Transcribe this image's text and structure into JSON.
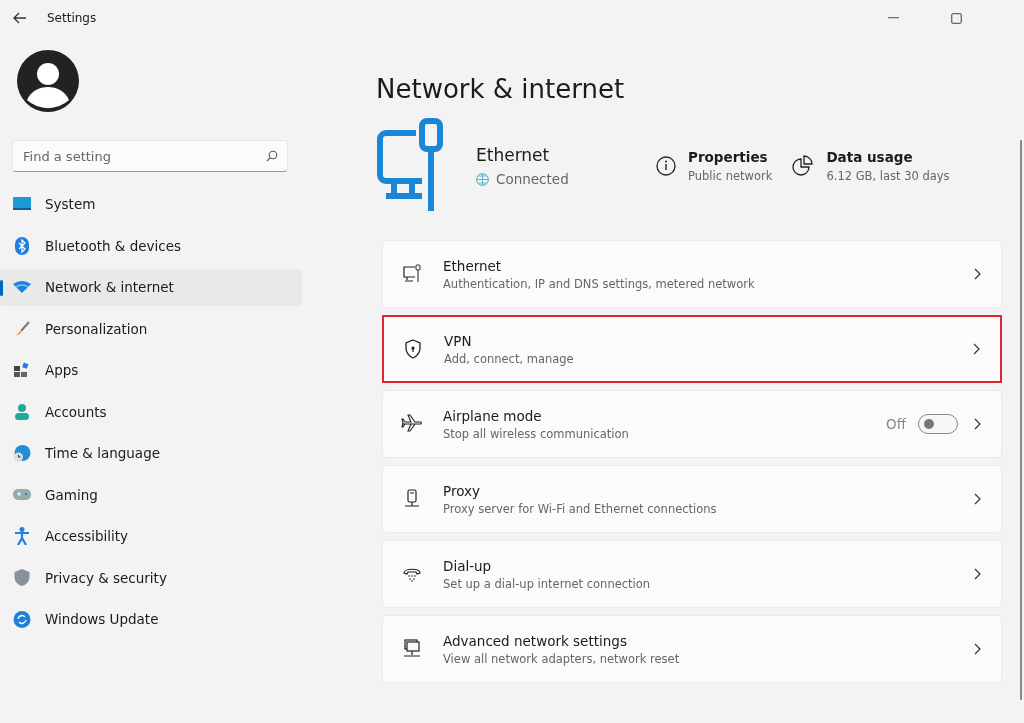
{
  "window": {
    "title": "Settings"
  },
  "search": {
    "placeholder": "Find a setting"
  },
  "sidebar": {
    "items": [
      {
        "label": "System",
        "selected": false
      },
      {
        "label": "Bluetooth & devices",
        "selected": false
      },
      {
        "label": "Network & internet",
        "selected": true
      },
      {
        "label": "Personalization",
        "selected": false
      },
      {
        "label": "Apps",
        "selected": false
      },
      {
        "label": "Accounts",
        "selected": false
      },
      {
        "label": "Time & language",
        "selected": false
      },
      {
        "label": "Gaming",
        "selected": false
      },
      {
        "label": "Accessibility",
        "selected": false
      },
      {
        "label": "Privacy & security",
        "selected": false
      },
      {
        "label": "Windows Update",
        "selected": false
      }
    ]
  },
  "page": {
    "title": "Network & internet"
  },
  "connection": {
    "name": "Ethernet",
    "status": "Connected",
    "properties": {
      "title": "Properties",
      "value": "Public network"
    },
    "data_usage": {
      "title": "Data usage",
      "value": "6.12 GB, last 30 days"
    }
  },
  "cards": [
    {
      "kind": "link",
      "title": "Ethernet",
      "subtitle": "Authentication, IP and DNS settings, metered network",
      "highlighted": false
    },
    {
      "kind": "link",
      "title": "VPN",
      "subtitle": "Add, connect, manage",
      "highlighted": true
    },
    {
      "kind": "toggle",
      "title": "Airplane mode",
      "subtitle": "Stop all wireless communication",
      "highlighted": false,
      "on": false,
      "state_label": "Off"
    },
    {
      "kind": "link",
      "title": "Proxy",
      "subtitle": "Proxy server for Wi-Fi and Ethernet connections",
      "highlighted": false
    },
    {
      "kind": "link",
      "title": "Dial-up",
      "subtitle": "Set up a dial-up internet connection",
      "highlighted": false
    },
    {
      "kind": "link",
      "title": "Advanced network settings",
      "subtitle": "View all network adapters, network reset",
      "highlighted": false
    }
  ]
}
